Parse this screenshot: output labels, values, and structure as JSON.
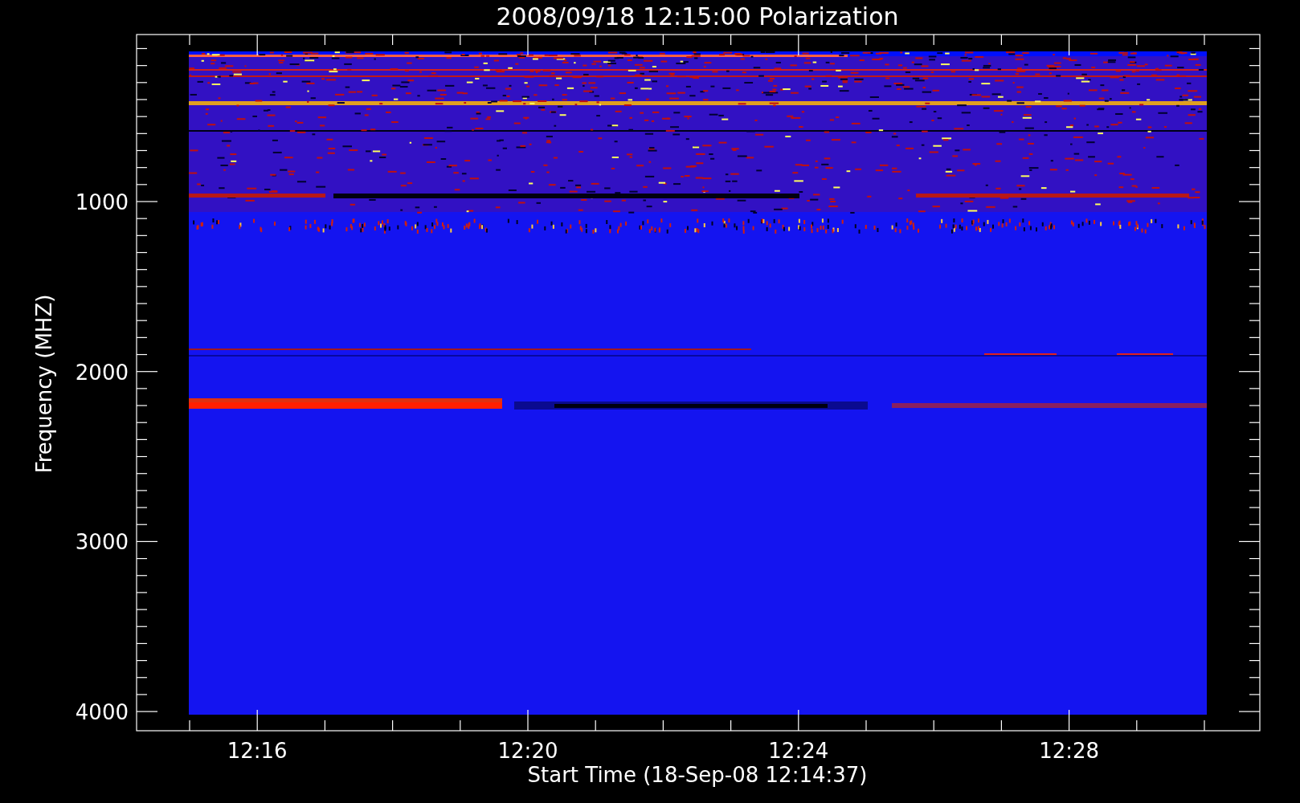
{
  "title": "2008/09/18 12:15:00 Polarization",
  "y_axis": {
    "label": "Frequency (MHZ)",
    "ticks": [
      "1000",
      "2000",
      "3000",
      "4000"
    ]
  },
  "x_axis": {
    "label": "Start Time (18-Sep-08 12:14:37)",
    "ticks": [
      "12:16",
      "12:20",
      "12:24",
      "12:28"
    ]
  }
}
